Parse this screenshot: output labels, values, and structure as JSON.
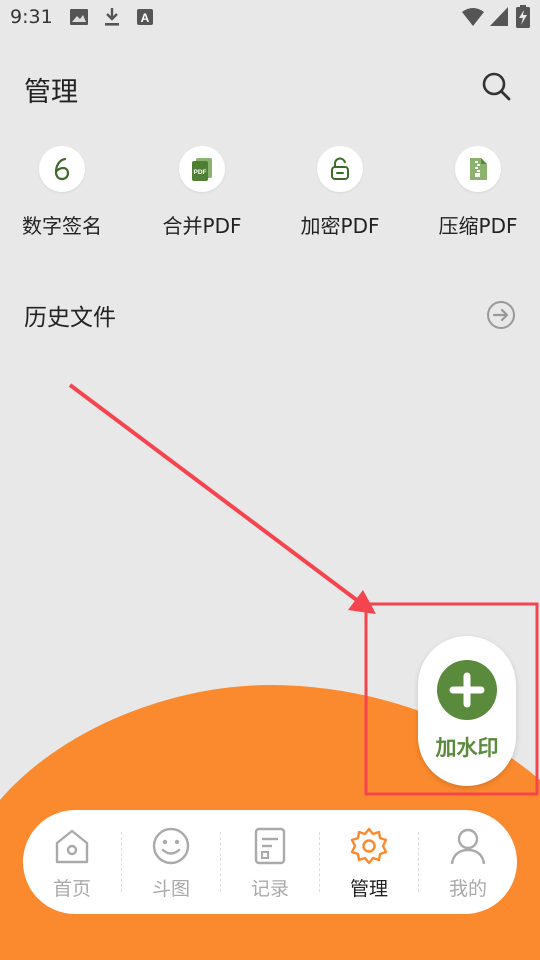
{
  "status_bar": {
    "time": "9:31",
    "icons_left": [
      "image-icon",
      "download-icon",
      "text-a-icon"
    ],
    "icons_right": [
      "wifi-icon",
      "cellular-icon",
      "battery-charging-icon"
    ]
  },
  "header": {
    "title": "管理",
    "search_icon": "search-icon"
  },
  "tools": [
    {
      "label": "数字签名",
      "icon": "digital-signature-icon"
    },
    {
      "label": "合并PDF",
      "icon": "pdf-merge-icon"
    },
    {
      "label": "加密PDF",
      "icon": "lock-icon"
    },
    {
      "label": "压缩PDF",
      "icon": "zip-file-icon"
    }
  ],
  "history": {
    "title": "历史文件",
    "icon": "arrow-right-circle-icon"
  },
  "fab": {
    "label": "加水印",
    "icon": "plus-icon"
  },
  "bottom_nav": {
    "items": [
      {
        "label": "首页",
        "icon": "home-icon",
        "active": false
      },
      {
        "label": "斗图",
        "icon": "smiley-icon",
        "active": false
      },
      {
        "label": "记录",
        "icon": "document-icon",
        "active": false
      },
      {
        "label": "管理",
        "icon": "gear-icon",
        "active": true
      },
      {
        "label": "我的",
        "icon": "user-icon",
        "active": false
      }
    ]
  },
  "colors": {
    "background": "#e8e8e8",
    "accent_orange": "#fb8a2e",
    "green": "#5a8a3c",
    "annotation_red": "#f4444e",
    "inactive_gray": "#aaaaaa"
  }
}
